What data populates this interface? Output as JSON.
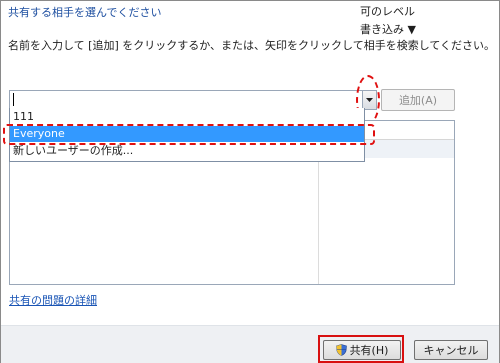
{
  "dialog": {
    "heading": "共有する相手を選んでください",
    "instruction": "名前を入力して [追加] をクリックするか、または、矢印をクリックして相手を検索してください。"
  },
  "input": {
    "value": ""
  },
  "add_button": {
    "label": "追加(A)"
  },
  "dropdown": {
    "items": [
      "111",
      "Everyone",
      "新しいユーザーの作成..."
    ],
    "selected": "Everyone"
  },
  "list": {
    "column_permission": "可のレベル",
    "row_permission": "書き込み ▼"
  },
  "problems_link": "共有の問題の詳細",
  "footer": {
    "share_label": "共有(H)",
    "cancel_label": "キャンセル"
  },
  "colors": {
    "highlight": "#3399ff",
    "annotation": "#e01010",
    "link": "#1a55b5"
  }
}
